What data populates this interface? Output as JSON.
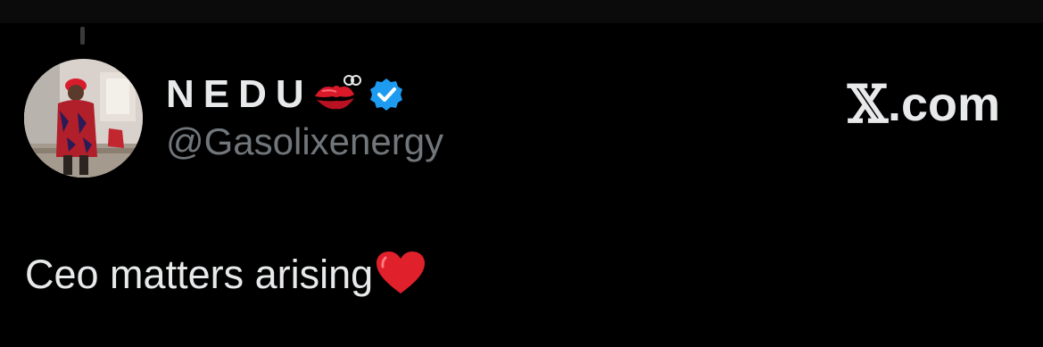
{
  "post": {
    "display_name": "NEDU",
    "handle": "@Gasolixenergy",
    "text": "Ceo matters arising",
    "name_emoji": "kiss-mark-icon",
    "text_emoji": "red-heart-icon",
    "verified": true
  },
  "brand": {
    "x_glyph": "𝕏",
    "suffix": ".com"
  },
  "colors": {
    "background": "#000000",
    "text_primary": "#e7e9ea",
    "text_secondary": "#71767b",
    "verified_blue": "#1d9bf0",
    "heart_red": "#e0202a"
  }
}
